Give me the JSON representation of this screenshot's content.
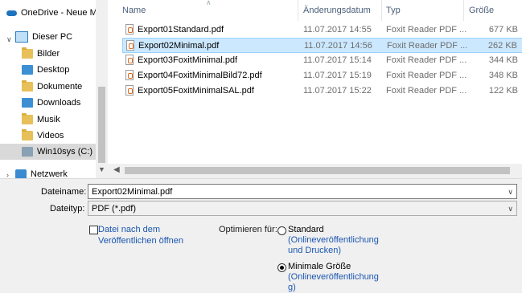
{
  "nav": {
    "items": [
      {
        "label": "OneDrive - Neue M",
        "icon": "cloud-icon"
      },
      {
        "label": "Dieser PC",
        "icon": "computer-icon"
      },
      {
        "label": "Bilder",
        "icon": "folder-icon"
      },
      {
        "label": "Desktop",
        "icon": "folder-icon"
      },
      {
        "label": "Dokumente",
        "icon": "folder-icon"
      },
      {
        "label": "Downloads",
        "icon": "download-folder-icon"
      },
      {
        "label": "Musik",
        "icon": "music-folder-icon"
      },
      {
        "label": "Videos",
        "icon": "video-folder-icon"
      },
      {
        "label": "Win10sys (C:)",
        "icon": "drive-icon"
      },
      {
        "label": "Netzwerk",
        "icon": "network-icon"
      }
    ],
    "selected": "Win10sys (C:)"
  },
  "columns": {
    "name": "Name",
    "date": "Änderungsdatum",
    "type": "Typ",
    "size": "Größe"
  },
  "files": [
    {
      "name": "Export01Standard.pdf",
      "date": "11.07.2017 14:55",
      "type": "Foxit Reader PDF ...",
      "size": "677 KB"
    },
    {
      "name": "Export02Minimal.pdf",
      "date": "11.07.2017 14:56",
      "type": "Foxit Reader PDF ...",
      "size": "262 KB"
    },
    {
      "name": "Export03FoxitMinimal.pdf",
      "date": "11.07.2017 15:14",
      "type": "Foxit Reader PDF ...",
      "size": "344 KB"
    },
    {
      "name": "Export04FoxitMinimalBild72.pdf",
      "date": "11.07.2017 15:19",
      "type": "Foxit Reader PDF ...",
      "size": "348 KB"
    },
    {
      "name": "Export05FoxitMinimalSAL.pdf",
      "date": "11.07.2017 15:22",
      "type": "Foxit Reader PDF ...",
      "size": "122 KB"
    }
  ],
  "selected_file": "Export02Minimal.pdf",
  "form": {
    "filename_label": "Dateiname:",
    "filename_value": "Export02Minimal.pdf",
    "filetype_label": "Dateityp:",
    "filetype_value": "PDF (*.pdf)",
    "open_after_publish_line1": "Datei nach dem",
    "open_after_publish_line2": "Veröffentlichen öffnen",
    "open_after_publish_checked": false,
    "optimize_label": "Optimieren für:",
    "standard_title": "Standard",
    "standard_line1": "(Onlineveröffentlichung",
    "standard_line2": "und Drucken)",
    "minimal_title": "Minimale Größe",
    "minimal_line1": "(Onlineveröffentlichung",
    "minimal_line2": "g)",
    "selected_optimization": "Minimale Größe"
  }
}
